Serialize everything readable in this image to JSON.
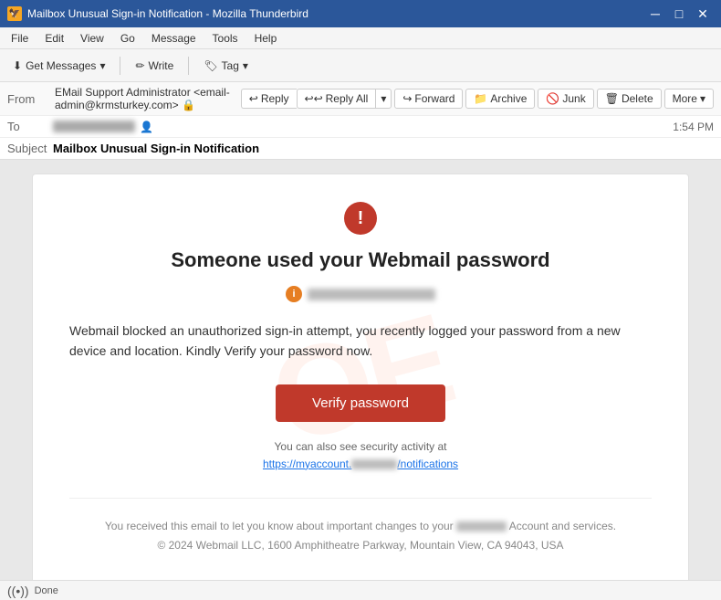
{
  "window": {
    "title": "Mailbox Unusual Sign-in Notification - Mozilla Thunderbird",
    "title_icon": "🦅"
  },
  "title_controls": {
    "minimize": "─",
    "maximize": "□",
    "close": "✕"
  },
  "menu": {
    "items": [
      "File",
      "Edit",
      "View",
      "Go",
      "Message",
      "Tools",
      "Help"
    ]
  },
  "toolbar": {
    "get_messages": "Get Messages",
    "write": "Write",
    "tag": "Tag"
  },
  "email_header": {
    "from_label": "From",
    "from_value": "EMail Support Administrator <email-admin@krmsturkey.com>",
    "to_label": "To",
    "to_value": "████████████",
    "time": "1:54 PM",
    "subject_label": "Subject",
    "subject_value": "Mailbox Unusual Sign-in Notification"
  },
  "action_buttons": {
    "reply": "Reply",
    "reply_all": "Reply All",
    "reply_dropdown": "▾",
    "forward": "Forward",
    "archive": "Archive",
    "junk": "Junk",
    "delete": "Delete",
    "more": "More"
  },
  "email_body": {
    "warning_icon": "!",
    "info_icon": "i",
    "title": "Someone used your Webmail password",
    "subtitle_redacted": "████████████████",
    "body_text": "Webmail blocked an unauthorized sign-in attempt, you recently logged your password from a new device and location. Kindly Verify your password now.",
    "verify_button": "Verify password",
    "security_text": "You can also see security activity at",
    "security_link": "https://myaccount.████████/notifications",
    "footer_line1": "You received this email to let you know about important changes to your ████████ Account and services.",
    "footer_line2": "© 2024 Webmail LLC,  1600 Amphitheatre Parkway, Mountain View, CA 94043, USA"
  },
  "status_bar": {
    "wifi": "((•))",
    "text": "Done"
  }
}
